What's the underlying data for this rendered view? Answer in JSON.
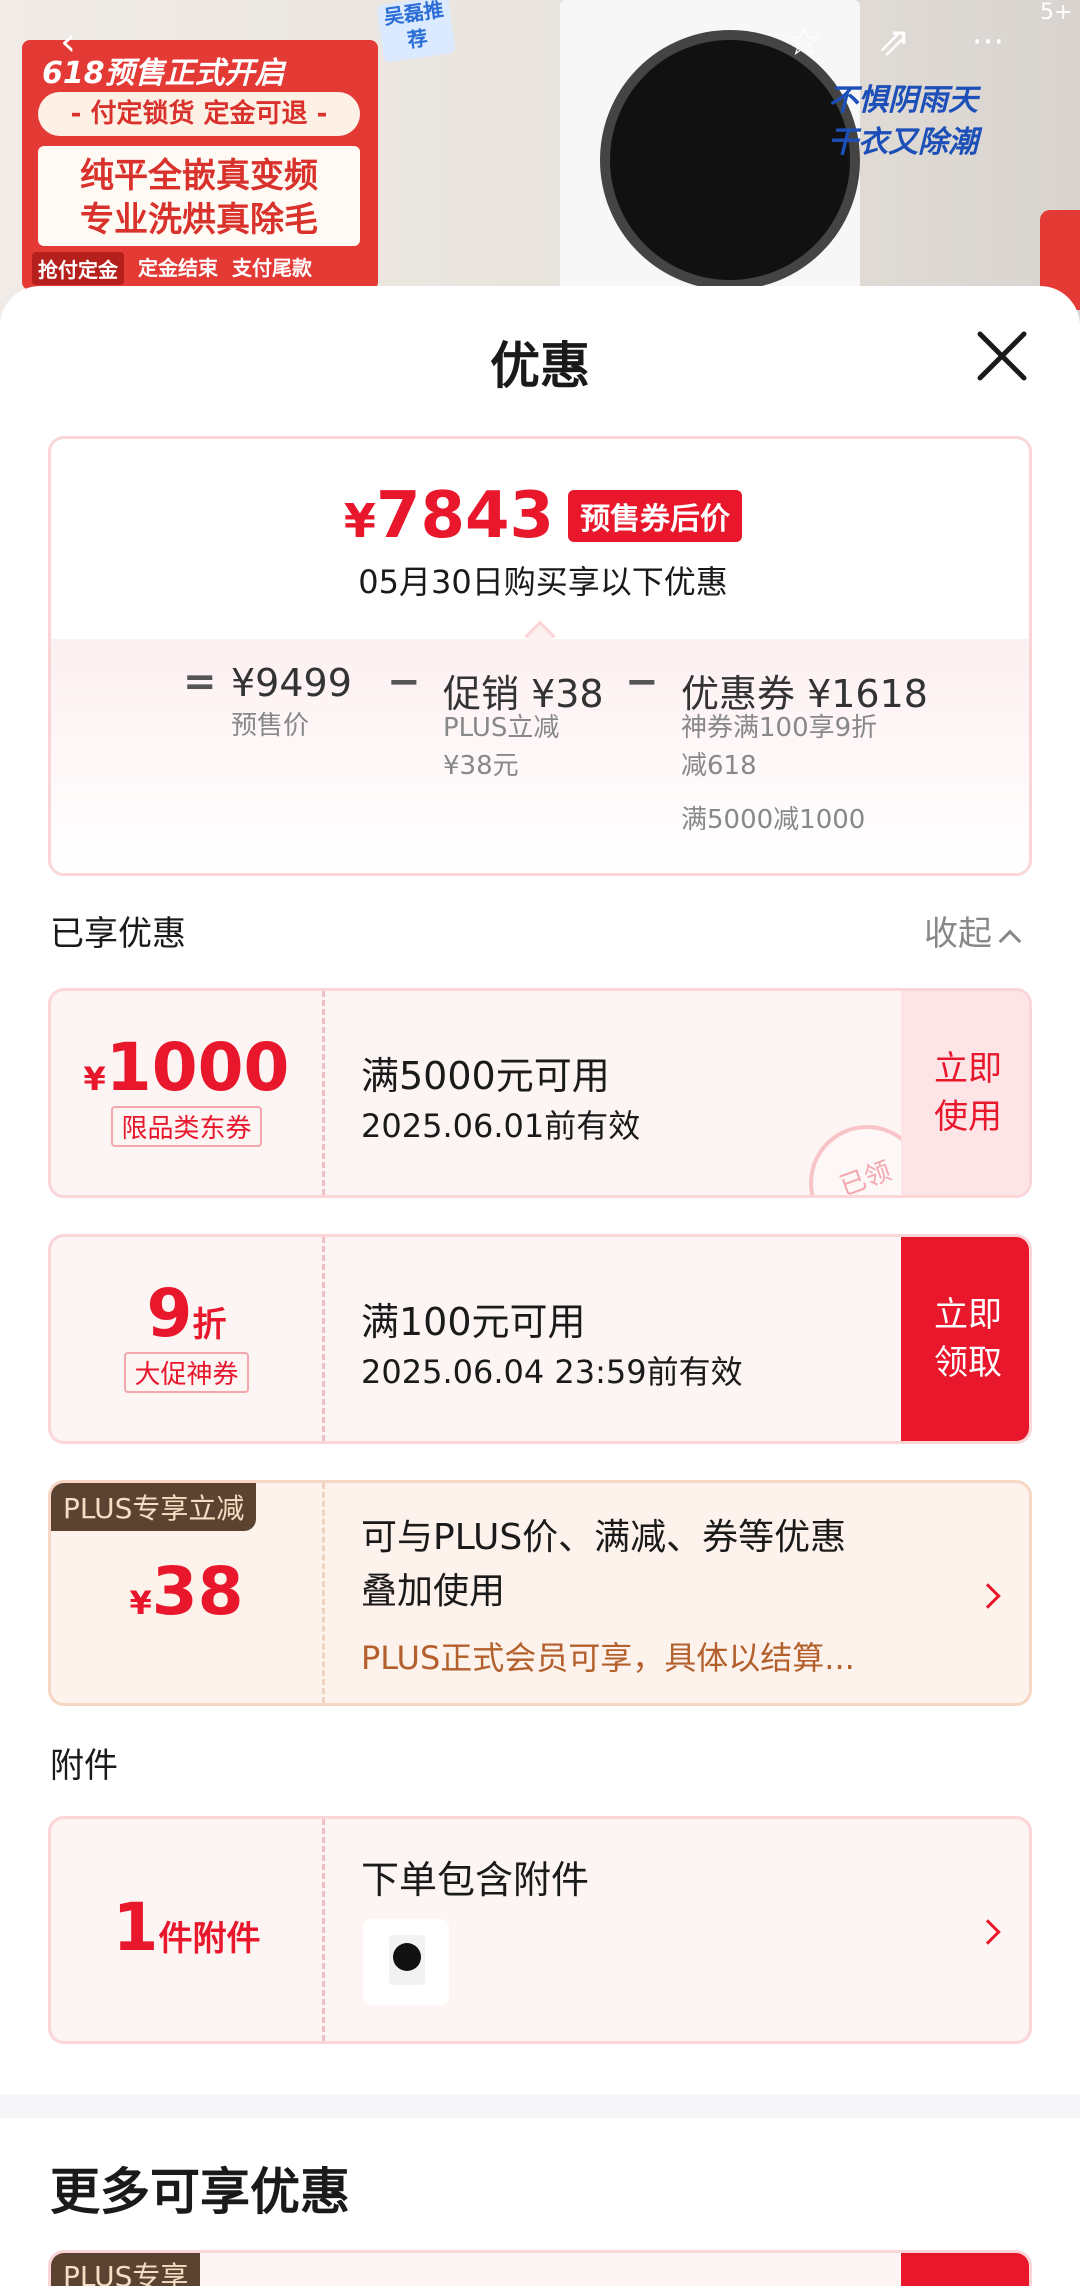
{
  "background": {
    "promo_title": "618预售正式开启",
    "promo_pill": "- 付定锁货 定金可退 -",
    "promo_line1": "纯平全嵌真变频",
    "promo_line2": "专业洗烘真除毛",
    "steps": [
      "抢付定金",
      "定金结束",
      "支付尾款"
    ],
    "badge": "吴磊推荐",
    "slogan_line1": "不惧阴雨天",
    "slogan_line2": "干衣又除潮",
    "count_badge": "5+"
  },
  "sheet": {
    "title": "优惠"
  },
  "summary": {
    "final_price": "7843",
    "price_tag": "预售券后价",
    "buy_date": "05月30日购买享以下优惠",
    "presale_price": "¥9499",
    "presale_label": "预售价",
    "promo_label": "促销 ¥38",
    "promo_sub1": "PLUS立减",
    "promo_sub2": "¥38元",
    "coupon_label": "优惠券 ¥1618",
    "coupon_sub1": "神券满100享9折",
    "coupon_sub2": "减618",
    "coupon_sub3": "满5000减1000",
    "equals": "=",
    "minus": "−"
  },
  "enjoyed": {
    "label": "已享优惠",
    "collapse": "收起"
  },
  "coupons": [
    {
      "amount": "1000",
      "tag": "限品类东券",
      "main": "满5000元可用",
      "sub": "2025.06.01前有效",
      "button": "立即使用",
      "stamp": "已领"
    },
    {
      "amount": "9",
      "unit": "折",
      "tag": "大促神券",
      "main": "满100元可用",
      "sub": "2025.06.04 23:59前有效",
      "button": "立即领取"
    }
  ],
  "plus": {
    "tag": "PLUS专享立减",
    "amount": "38",
    "desc_line1": "可与PLUS价、满减、券等优惠",
    "desc_line2": "叠加使用",
    "note": "PLUS正式会员可享，具体以结算..."
  },
  "attachment": {
    "section": "附件",
    "count": "1",
    "unit": "件附件",
    "main": "下单包含附件"
  },
  "more": {
    "title": "更多可享优惠",
    "peek_tag": "PLUS专享"
  },
  "currency": "¥",
  "colors": {
    "accent": "#e8172c",
    "plus_brown": "#5c4331"
  }
}
